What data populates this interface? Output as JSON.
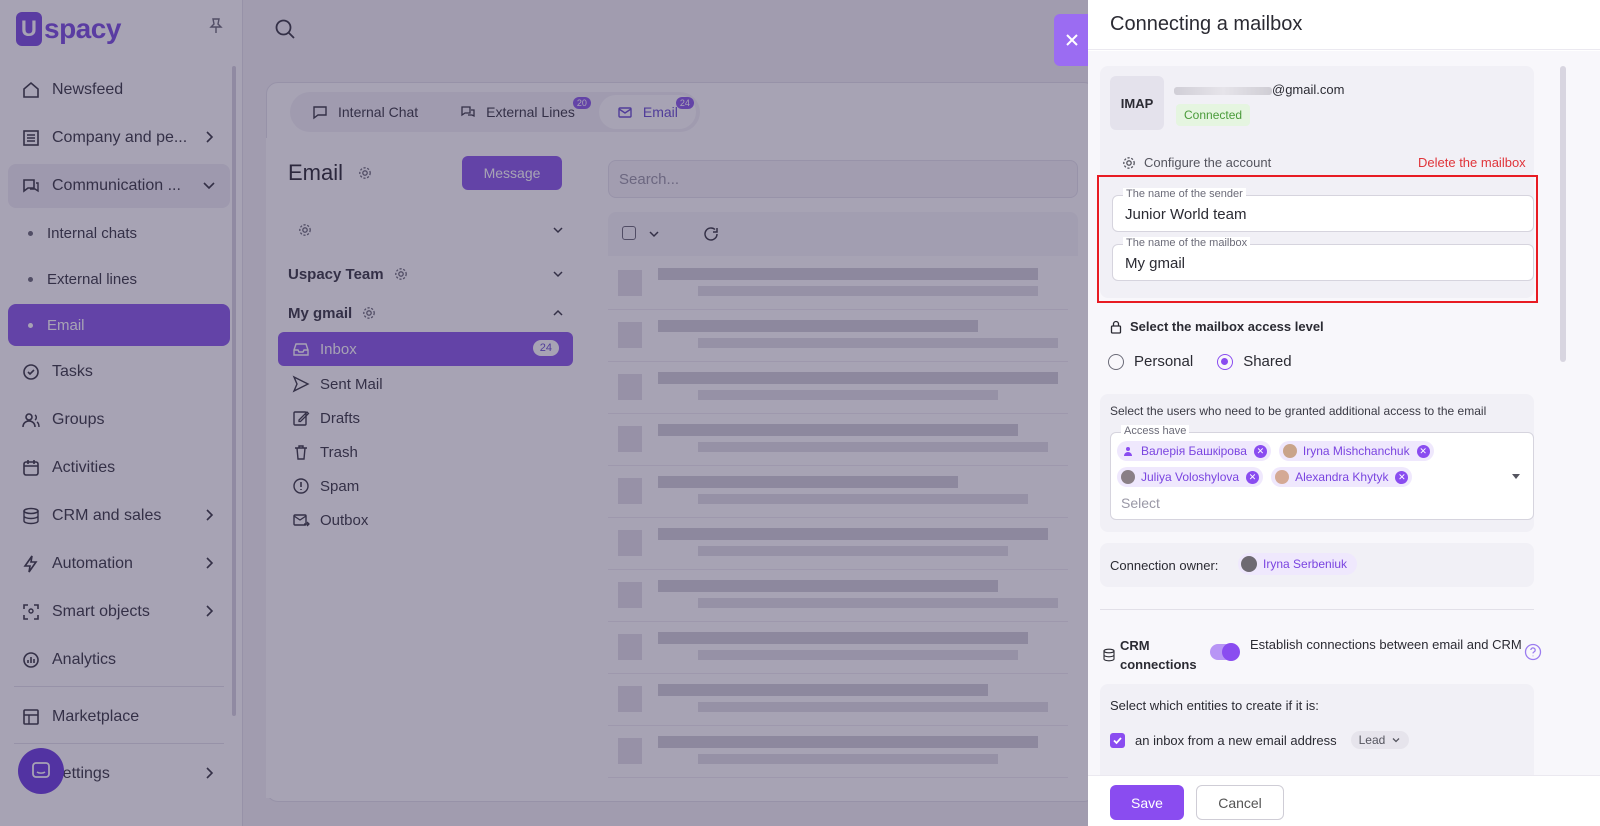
{
  "app": {
    "logo_text": "spacy",
    "logo_mark": "U"
  },
  "sidebar": {
    "items": [
      {
        "label": "Newsfeed",
        "icon": "home-icon"
      },
      {
        "label": "Company and pe...",
        "icon": "company-icon"
      },
      {
        "label": "Communication ...",
        "icon": "communication-icon"
      },
      {
        "label": "Internal chats"
      },
      {
        "label": "External lines"
      },
      {
        "label": "Email"
      },
      {
        "label": "Tasks",
        "icon": "tasks-icon"
      },
      {
        "label": "Groups",
        "icon": "groups-icon"
      },
      {
        "label": "Activities",
        "icon": "calendar-icon"
      },
      {
        "label": "CRM and sales",
        "icon": "crm-icon"
      },
      {
        "label": "Automation",
        "icon": "lightning-icon"
      },
      {
        "label": "Smart objects",
        "icon": "smart-objects-icon"
      },
      {
        "label": "Analytics",
        "icon": "analytics-icon"
      },
      {
        "label": "Marketplace",
        "icon": "marketplace-icon"
      },
      {
        "label": "Settings",
        "icon": "gear-icon"
      }
    ]
  },
  "tabs": [
    {
      "label": "Internal Chat",
      "badge": ""
    },
    {
      "label": "External Lines",
      "badge": "20"
    },
    {
      "label": "Email",
      "badge": "24"
    }
  ],
  "email_panel": {
    "title": "Email",
    "message_button": "Message",
    "mailboxes": [
      {
        "name": ""
      },
      {
        "name": "Uspacy Team"
      },
      {
        "name": "My gmail"
      }
    ],
    "folders": [
      {
        "label": "Inbox",
        "count": "24"
      },
      {
        "label": "Sent Mail"
      },
      {
        "label": "Drafts"
      },
      {
        "label": "Trash"
      },
      {
        "label": "Spam"
      },
      {
        "label": "Outbox"
      }
    ],
    "search_placeholder": "Search..."
  },
  "drawer": {
    "title": "Connecting a mailbox",
    "account": {
      "protocol": "IMAP",
      "email_suffix": "@gmail.com",
      "status": "Connected",
      "configure_label": "Configure the account",
      "delete_label": "Delete the mailbox"
    },
    "sender_field": {
      "label": "The name of the sender",
      "value": "Junior World team"
    },
    "mailbox_field": {
      "label": "The name of the mailbox",
      "value": "My gmail"
    },
    "access": {
      "title": "Select the mailbox access level",
      "options": [
        "Personal",
        "Shared"
      ],
      "selected": "Shared"
    },
    "users": {
      "description": "Select the users who need to be granted additional access to the email",
      "field_label": "Access have",
      "chips": [
        "Валерія Башкірова",
        "Iryna Mishchanchuk",
        "Juliya Voloshylova",
        "Alexandra Khytyk"
      ],
      "placeholder": "Select"
    },
    "owner": {
      "label": "Connection owner:",
      "name": "Iryna Serbeniuk"
    },
    "crm": {
      "label": "CRM connections",
      "toggle_on": true,
      "description": "Establish connections between email and CRM"
    },
    "entities": {
      "title": "Select which entities to create if it is:",
      "row_label": "an inbox from a new email address",
      "row_value": "Lead"
    },
    "footer": {
      "save": "Save",
      "cancel": "Cancel"
    }
  },
  "colors": {
    "accent": "#8a4cf0",
    "highlight_border": "#e81b23",
    "delete": "#e0343a",
    "connected": "#4a9b3a"
  }
}
